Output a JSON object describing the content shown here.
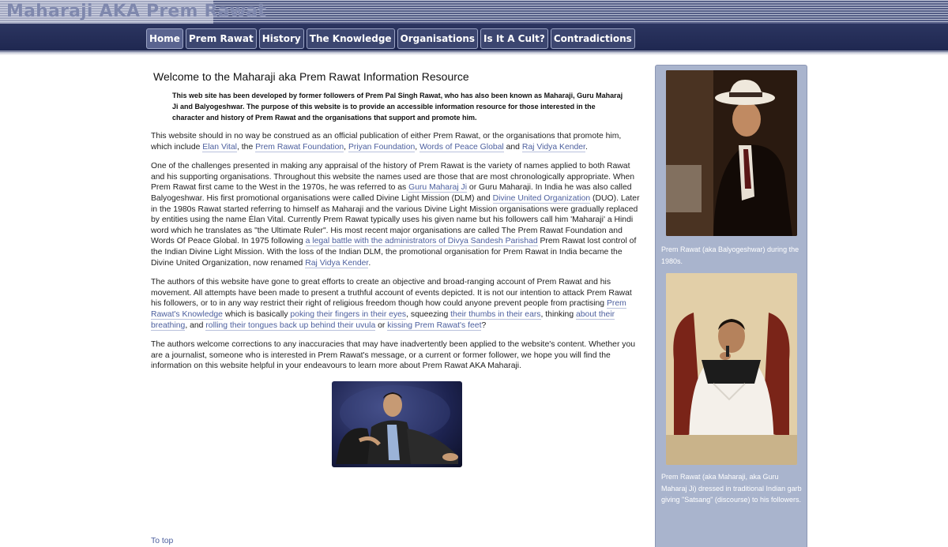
{
  "header": {
    "site_title": "Maharaji AKA Prem Rawat",
    "nav": [
      {
        "label": "Home"
      },
      {
        "label": "Prem Rawat"
      },
      {
        "label": "History"
      },
      {
        "label": "The Knowledge"
      },
      {
        "label": "Organisations"
      },
      {
        "label": "Is It A Cult?"
      },
      {
        "label": "Contradictions"
      }
    ]
  },
  "main": {
    "heading": "Welcome to the Maharaji aka Prem Rawat Information Resource",
    "intro": "This web site has been developed by former followers of Prem Pal Singh Rawat, who has also been known as Maharaji, Guru Maharaj Ji and Balyogeshwar. The purpose of this website is to provide an accessible information resource for those interested in the character and history of Prem Rawat and the organisations that support and promote him.",
    "p1": {
      "t1": "This website should in no way be construed as an official publication of either Prem Rawat, or the organisations that promote him, which include ",
      "l1": "Elan Vital",
      "t2": ", the ",
      "l2": "Prem Rawat Foundation",
      "t3": ", ",
      "l3": "Priyan Foundation",
      "t4": ", ",
      "l4": "Words of Peace Global",
      "t5": " and ",
      "l5": "Raj Vidya Kender",
      "t6": "."
    },
    "p2": {
      "t1": "One of the challenges presented in making any appraisal of the history of Prem Rawat is the variety of names applied to both Rawat and his supporting organisations. Throughout this website the names used are those that are most chronologically appropriate. When Prem Rawat first came to the West in the 1970s, he was referred to as ",
      "l1": "Guru Maharaj Ji",
      "t2": " or Guru Maharaji. In India he was also called Balyogeshwar. His first promotional organisations were called Divine Light Mission (DLM) and ",
      "l2": "Divine United Organization",
      "t3": " (DUO). Later in the 1980s Rawat started referring to himself as Maharaji and the various Divine Light Mission organisations were gradually replaced by entities using the name Élan Vital. Currently Prem Rawat typically uses his given name but his followers call him 'Maharaji' a Hindi word which he translates as \"the Ultimate Ruler\". His most recent major organisations are called The Prem Rawat Foundation and Words Of Peace Global. In 1975 following ",
      "l3": "a legal battle with the administrators of Divya Sandesh Parishad",
      "t4": " Prem Rawat lost control of the Indian Divine Light Mission. With the loss of the Indian DLM, the promotional organisation for Prem Rawat in India became the Divine United Organization, now renamed ",
      "l4": "Raj Vidya Kender",
      "t5": "."
    },
    "p3": {
      "t1": "The authors of this website have gone to great efforts to create an objective and broad-ranging account of Prem Rawat and his movement. All attempts have been made to present a truthful account of events depicted. It is not our intention to attack Prem Rawat his followers, or to in any way restrict their right of religious freedom though how could anyone prevent people from practising ",
      "l1": "Prem Rawat's Knowledge",
      "t2": " which is basically ",
      "l2": "poking their fingers in their eyes",
      "t3": ", squeezing ",
      "l3": "their thumbs in their ears",
      "t4": ", thinking ",
      "l4": "about their breathing",
      "t5": ", and ",
      "l5": "rolling their tongues back up behind their uvula",
      "t6": " or ",
      "l6": "kissing Prem Rawat's feet",
      "t7": "?"
    },
    "p4": "The authors welcome corrections to any inaccuracies that may have inadvertently been applied to the website's content. Whether you are a journalist, someone who is interested in Prem Rawat's message, or a current or former follower, we hope you will find the information on this website helpful in your endeavours to learn more about Prem Rawat AKA Maharaji.",
    "to_top": "To top"
  },
  "sidebar": {
    "caption1": "Prem Rawat (aka Balyogeshwar) during the 1980s.",
    "caption2": "Prem Rawat (aka Maharaji, aka Guru Maharaj Ji) dressed in traditional Indian garb giving \"Satsang\" (discourse) to his followers."
  },
  "colors": {
    "header_bg": "#2c3560",
    "nav_button": "#3c4670",
    "link": "#4c5f9e",
    "sidebar_bg": "#a9b4cd"
  }
}
